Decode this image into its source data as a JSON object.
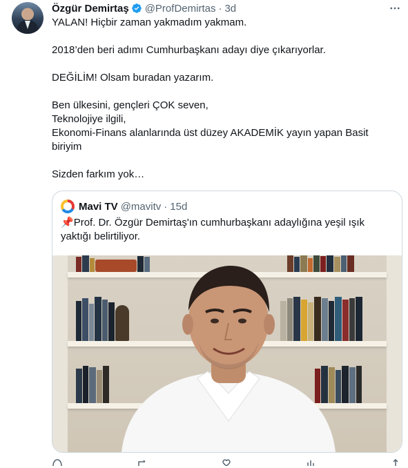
{
  "tweet": {
    "author_name": "Özgür Demirtaş",
    "handle": "@ProfDemirtas",
    "separator": "·",
    "time": "3d",
    "text": {
      "p1": "YALAN! Hiçbir zaman yakmadım yakmam.",
      "p2": "2018’den beri adımı Cumhurbaşkanı adayı diye çıkarıyorlar.",
      "p3": "DEĞİLİM! Olsam buradan yazarım.",
      "p4_line1": "Ben ülkesini, gençleri ÇOK seven,",
      "p4_line2": "Teknolojiye ilgili,",
      "p4_line3": "Ekonomi-Finans alanlarında üst düzey AKADEMİK yayın yapan Basit biriyim",
      "p5": "Sizden farkım yok…"
    }
  },
  "quote": {
    "author_name": "Mavi TV",
    "handle": "@mavitv",
    "separator": "·",
    "time": "15d",
    "pin_emoji": "📌",
    "text": "Prof. Dr. Özgür Demirtaş'ın cumhurbaşkanı adaylığına yeşil ışık yaktığı belirtiliyor."
  },
  "colors": {
    "text": "#0f1419",
    "secondary": "#536471",
    "border": "#cfd9de",
    "verified": "#1d9bf0"
  },
  "icons": {
    "verified": "verified-badge-icon",
    "more": "more-horizontal-icon",
    "quote_logo": "mavitv-logo-icon"
  }
}
